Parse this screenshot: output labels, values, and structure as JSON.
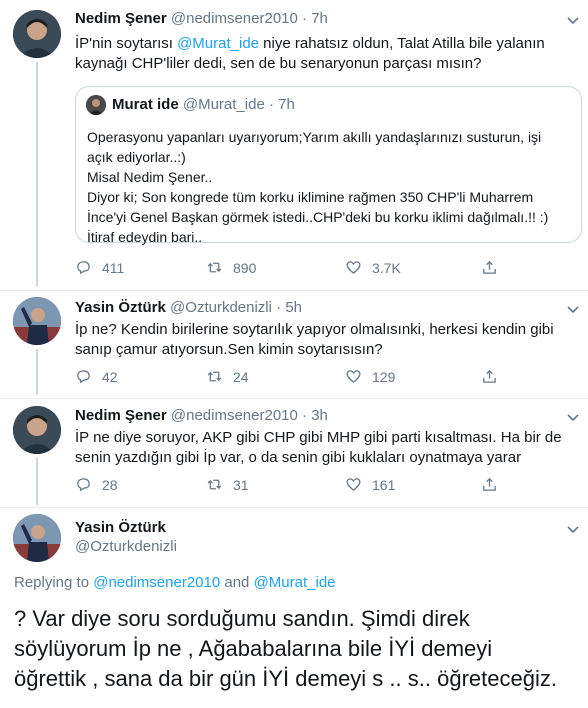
{
  "tweets": [
    {
      "name": "Nedim Şener",
      "handle": "@nedimsener2010",
      "time": "7h",
      "text_prefix": "İP'nin soytarısı ",
      "text_mention": "@Murat_ide",
      "text_suffix_1": " niye rahatsız oldun, Talat Atilla bile yalanın",
      "text_line2": "kaynağı CHP'liler dedi, sen de bu senaryonun parçası mısın?",
      "quote": {
        "name": "Murat ide",
        "handle": "@Murat_ide",
        "time": "7h",
        "lines": [
          "Operasyonu yapanları uyarıyorum;Yarım akıllı yandaşlarınızı susturun, işi",
          "açık ediyorlar..:)",
          "Misal Nedim Şener..",
          "Diyor ki; Son kongrede tüm korku iklimine rağmen 350 CHP'li Muharrem",
          "İnce'yi Genel Başkan görmek istedi..CHP'deki bu korku iklimi dağılmalı.!! :)",
          "İtiraf edeydin bari.."
        ]
      },
      "replies": "411",
      "retweets": "890",
      "likes": "3.7K"
    },
    {
      "name": "Yasin Öztürk",
      "handle": "@Ozturkdenizli",
      "time": "5h",
      "lines": [
        "İp ne? Kendin birilerine soytarılık yapıyor olmalısınki, herkesi kendin gibi",
        "sanıp çamur atıyorsun.Sen kimin soytarısısın?"
      ],
      "replies": "42",
      "retweets": "24",
      "likes": "129"
    },
    {
      "name": "Nedim Şener",
      "handle": "@nedimsener2010",
      "time": "3h",
      "lines": [
        "İP ne diye soruyor, AKP gibi CHP gibi MHP gibi parti kısaltması. Ha bir de",
        "senin yazdığın gibi İp var, o da senin gibi kuklaları oynatmaya yarar"
      ],
      "replies": "28",
      "retweets": "31",
      "likes": "161"
    }
  ],
  "main": {
    "name": "Yasin Öztürk",
    "handle": "@Ozturkdenizli",
    "replying_prefix": "Replying to ",
    "replying_to_1": "@nedimsener2010",
    "replying_and": " and ",
    "replying_to_2": "@Murat_ide",
    "lines": [
      "? Var diye soru sorduğumu sandın. Şimdi direk",
      "söylüyorum İp ne , Ağababalarına bile İYİ demeyi",
      "öğrettik , sana da bir gün İYİ demeyi s .. s.. öğreteceğiz."
    ]
  },
  "sep": "·",
  "colors": {
    "accent": "#1da1f2",
    "secondary": "#657786",
    "border": "#ccd6dd"
  },
  "icons": [
    "reply-icon",
    "retweet-icon",
    "like-icon",
    "share-icon",
    "caret-down-icon"
  ]
}
